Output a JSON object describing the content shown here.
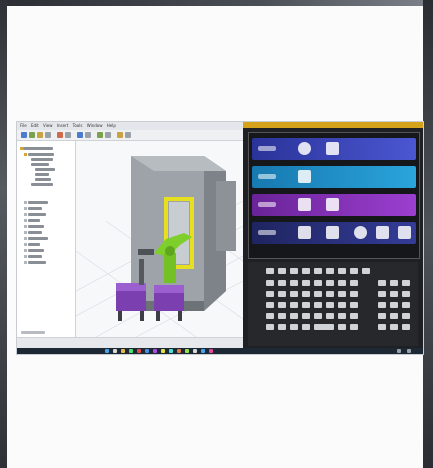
{
  "cad_window": {
    "menu": [
      "File",
      "Edit",
      "View",
      "Insert",
      "Tools",
      "Window",
      "Help"
    ],
    "status_left": "",
    "status_right": ""
  },
  "hmi": {
    "title": "",
    "bands": [
      {
        "name": "menu-row-1",
        "color": "#3b47b8"
      },
      {
        "name": "menu-row-2",
        "color": "#1e8fc8"
      },
      {
        "name": "menu-row-3",
        "color": "#7b2fb5"
      },
      {
        "name": "menu-row-4",
        "color": "#2a2f7a"
      }
    ]
  },
  "colors": {
    "hmi_title": "#d4a21b",
    "robot": "#7ecf2c",
    "machine_frame": "#e6e021",
    "pallet": "#7b3fb0"
  }
}
